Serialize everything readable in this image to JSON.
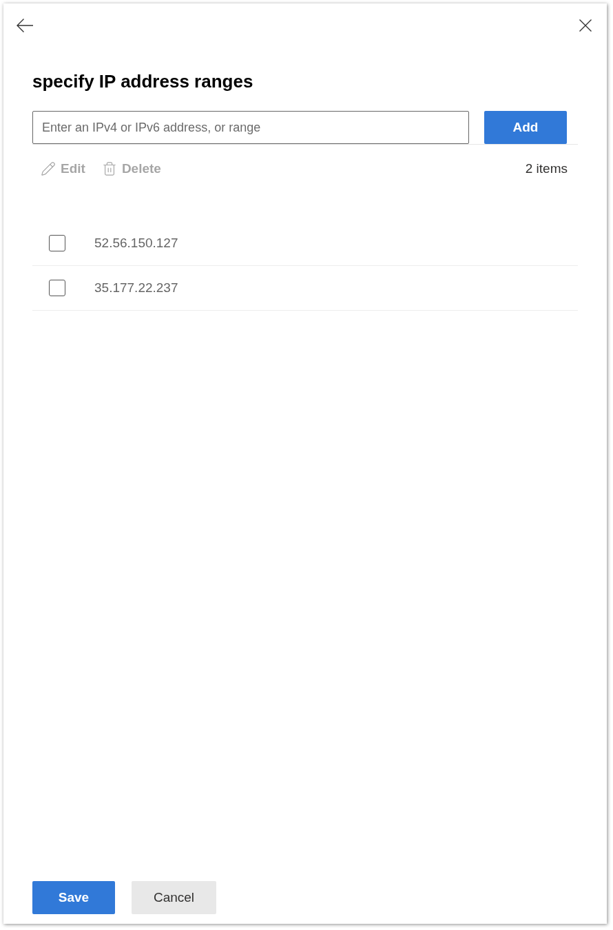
{
  "title": "specify IP address ranges",
  "address_input": {
    "placeholder": "Enter an IPv4 or IPv6 address, or range"
  },
  "add_button": {
    "label": "Add"
  },
  "toolbar": {
    "actions": [
      {
        "kind": "edit",
        "label": "Edit",
        "disabled": true
      },
      {
        "kind": "delete",
        "label": "Delete",
        "disabled": true
      }
    ],
    "count": "2 items"
  },
  "rows": [
    {
      "address": "52.56.150.127",
      "checked": false
    },
    {
      "address": "35.177.22.237",
      "checked": false
    }
  ],
  "footer": {
    "buttons": [
      {
        "kind": "primary",
        "label": "Save"
      },
      {
        "kind": "secondary",
        "label": "Cancel"
      }
    ]
  }
}
